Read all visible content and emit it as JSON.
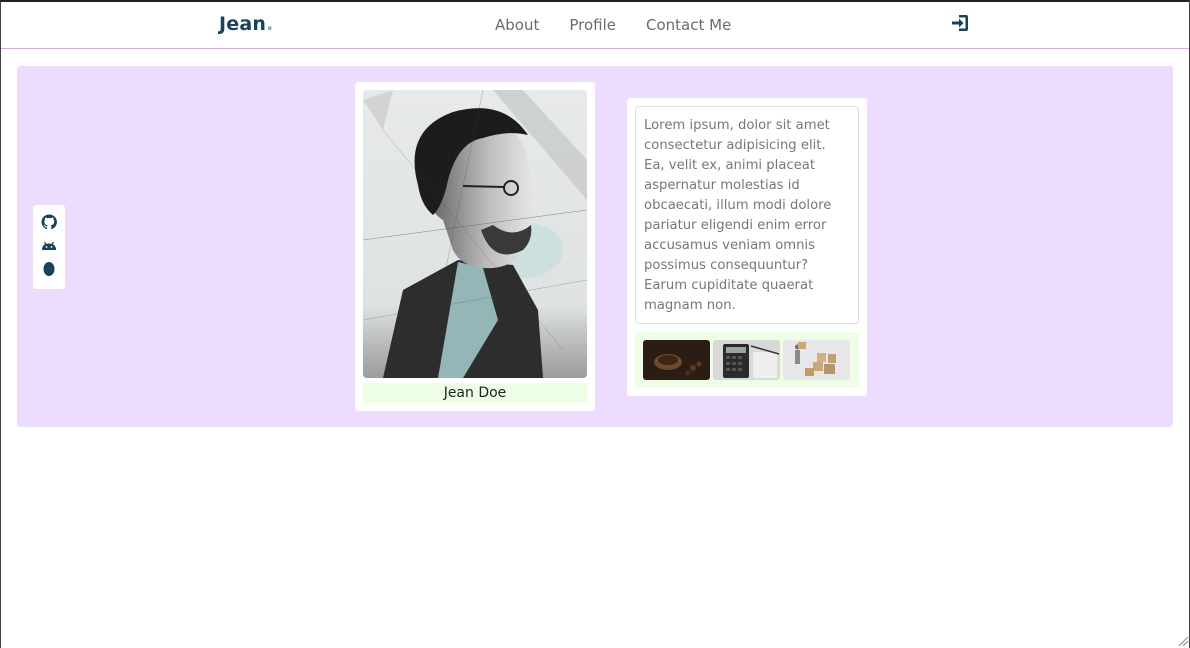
{
  "navbar": {
    "brand": "Jean",
    "brand_dot": ".",
    "links": [
      "About",
      "Profile",
      "Contact Me"
    ],
    "login_icon": "sign-in-icon"
  },
  "social": {
    "icons": [
      "github-icon",
      "android-icon",
      "egg-icon"
    ]
  },
  "profile": {
    "name": "Jean Doe",
    "photo_icon": "portrait-image"
  },
  "bio": {
    "text": "Lorem ipsum, dolor sit amet consectetur adipisicing elit. Ea, velit ex, animi placeat aspernatur molestias id obcaecati, illum modi dolore pariatur eligendi enim error accusamus veniam omnis possimus consequuntur? Earum cupiditate quaerat magnam non."
  },
  "gallery": {
    "thumbnails": [
      "coffee-thumbnail",
      "calculator-thumbnail",
      "boxes-thumbnail"
    ]
  },
  "colors": {
    "brand": "#17435a",
    "hero_bg": "#ecdcfe",
    "accent_green": "#eefde5",
    "nav_text": "#6b6b6b"
  }
}
